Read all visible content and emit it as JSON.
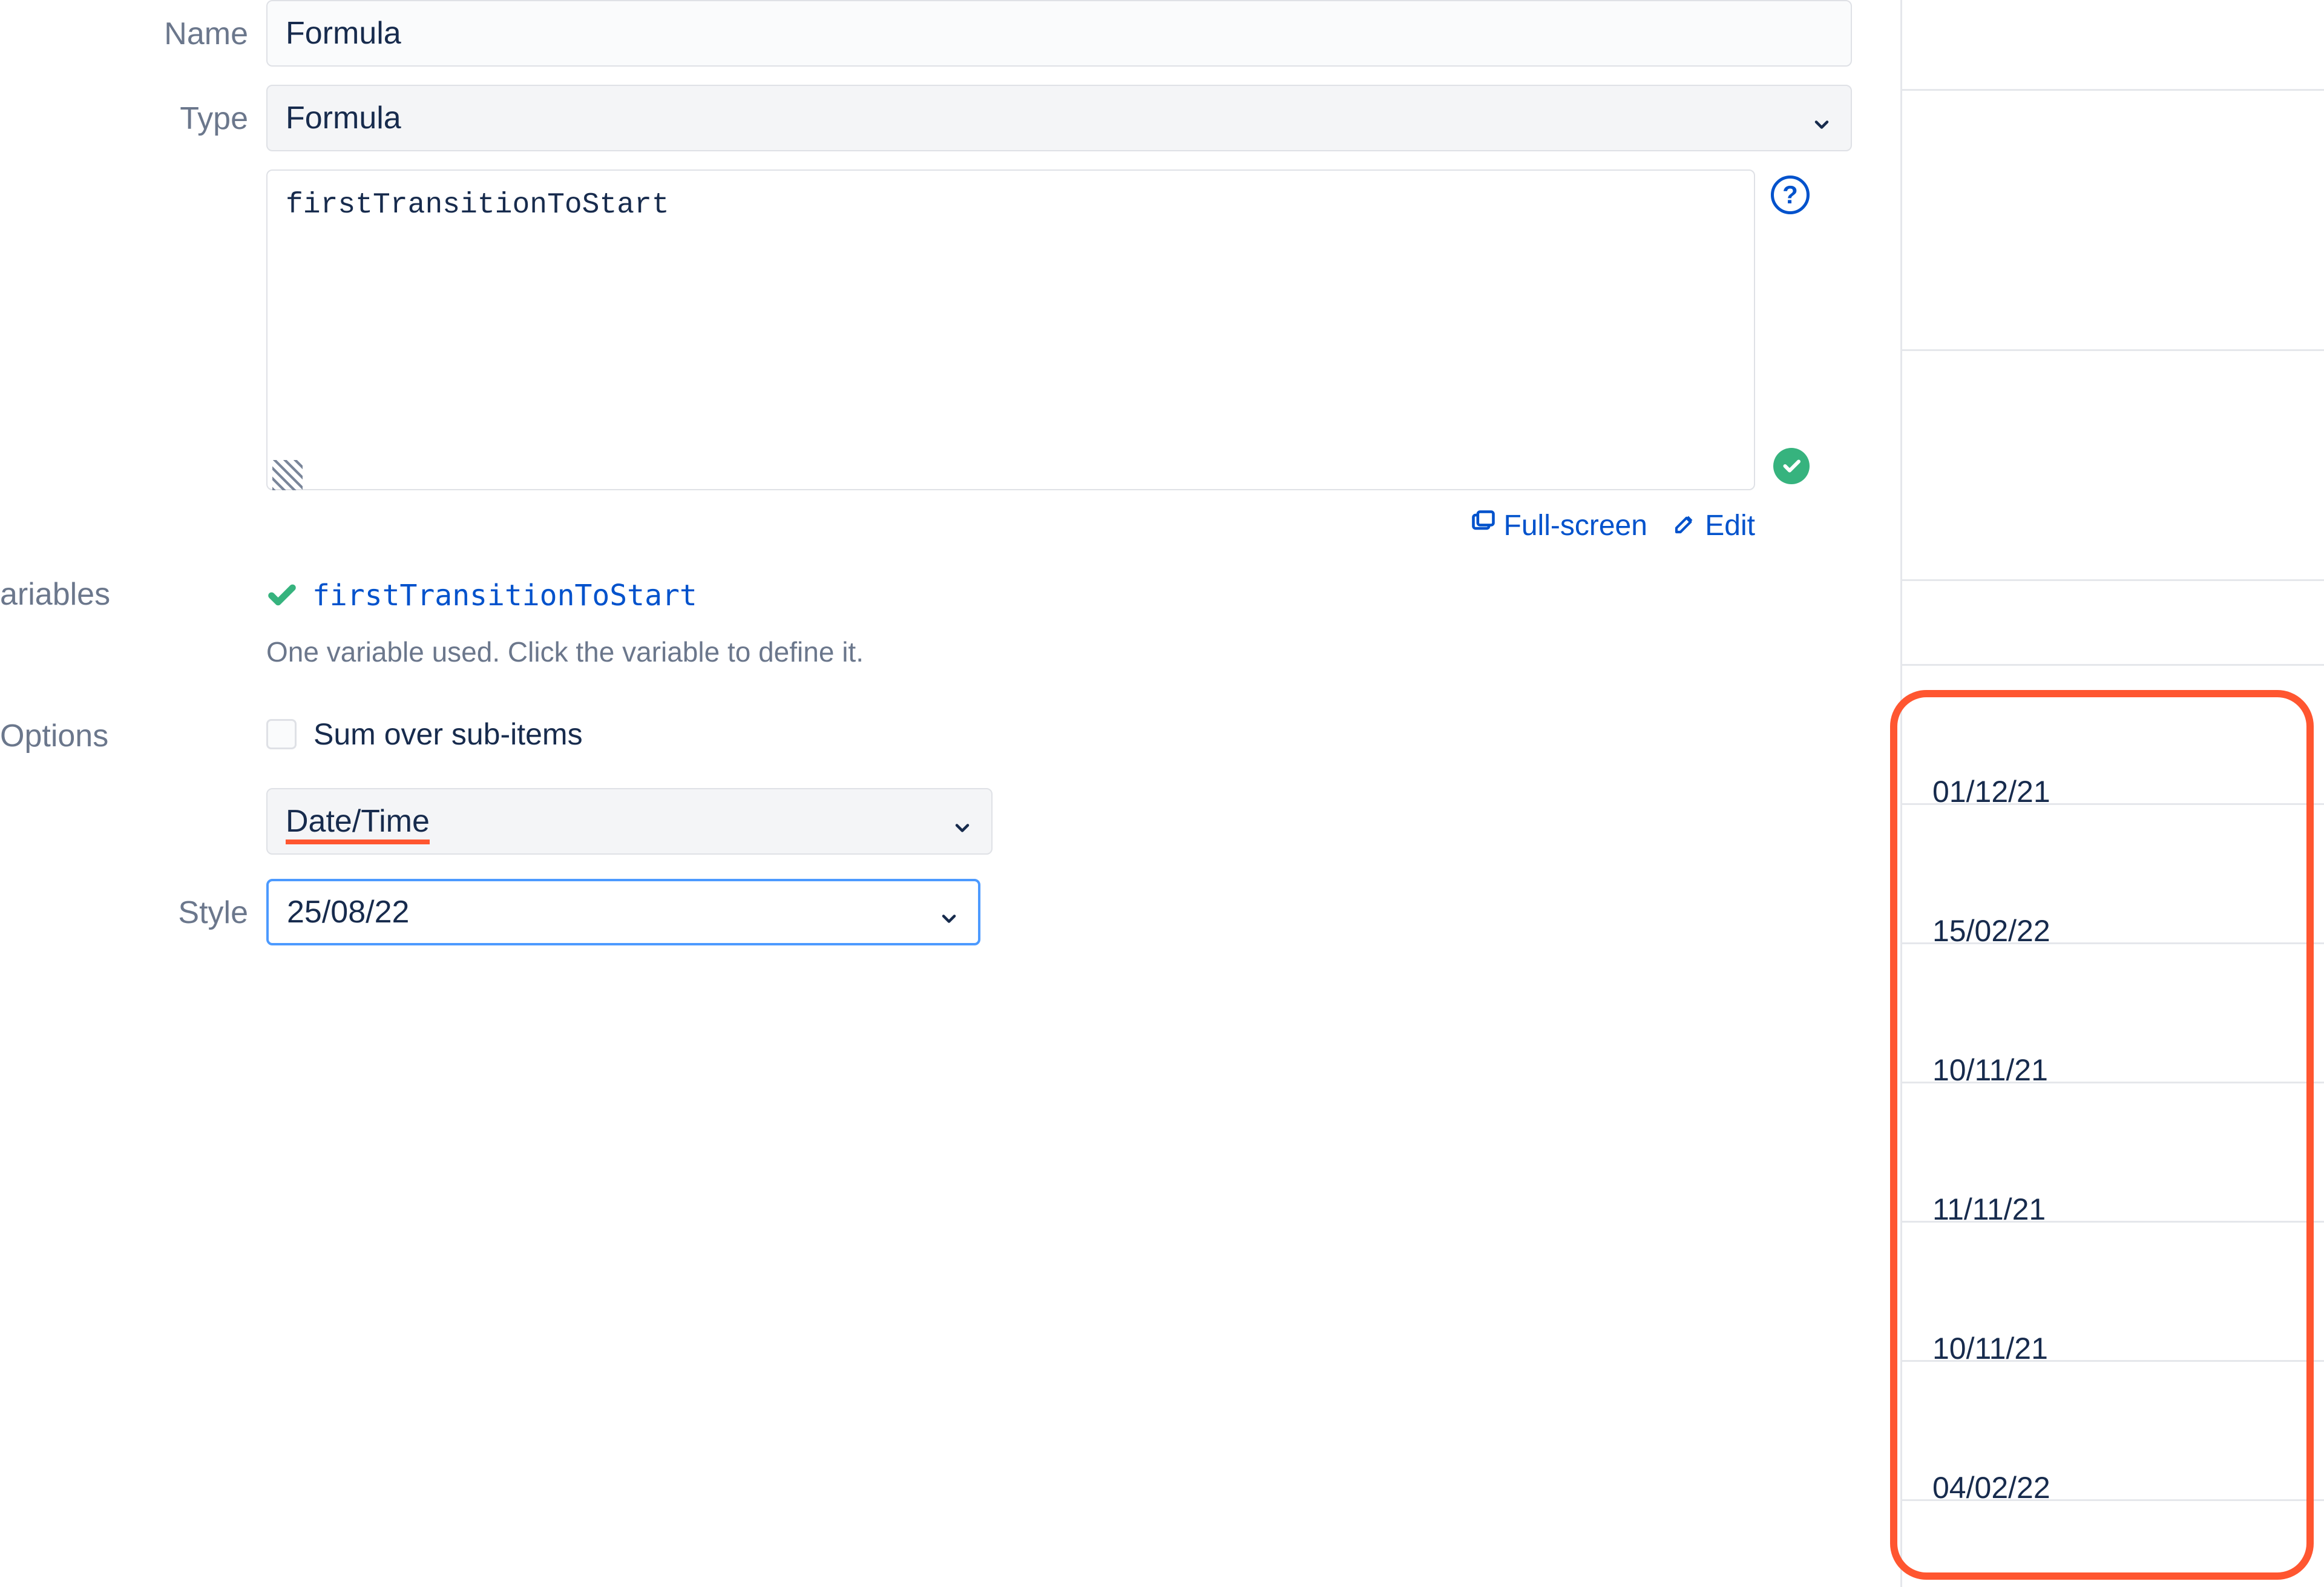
{
  "labels": {
    "name": "Name",
    "type": "Type",
    "variables": "ariables",
    "options": "Options",
    "style": "Style"
  },
  "fields": {
    "name_value": "Formula",
    "type_value": "Formula",
    "formula_code": "firstTransitionToStart",
    "variable_name": "firstTransitionToStart",
    "variable_hint": "One variable used. Click the variable to define it.",
    "sum_label": "Sum over sub-items",
    "format_value": "Date/Time",
    "style_value": "25/08/22"
  },
  "actions": {
    "fullscreen": "Full-screen",
    "edit": "Edit"
  },
  "icons": {
    "help": "?",
    "check_white": "✓"
  },
  "result_dates": [
    "01/12/21",
    "15/02/22",
    "10/11/21",
    "11/11/21",
    "10/11/21",
    "04/02/22"
  ]
}
